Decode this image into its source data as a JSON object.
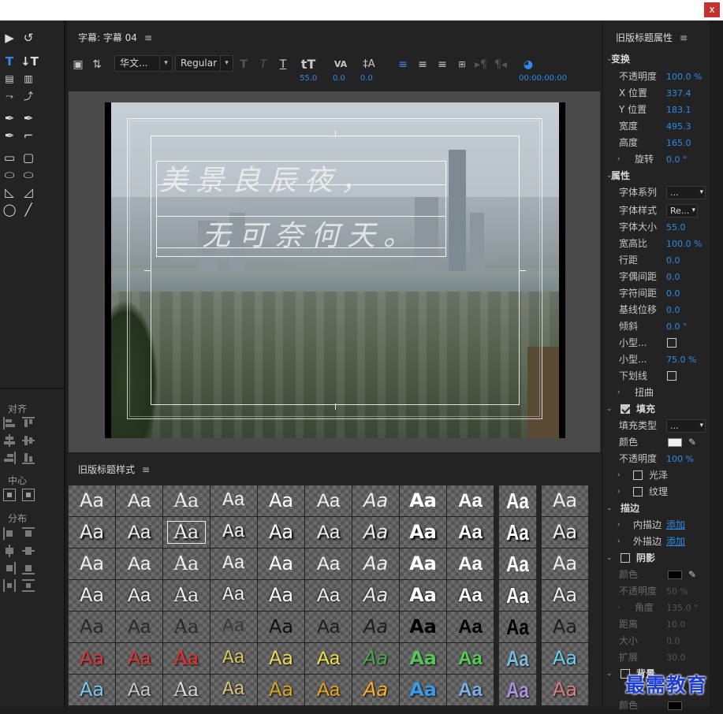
{
  "window": {
    "close_label": "x"
  },
  "title_panel": {
    "tab_label": "字幕: 字幕 04",
    "menu_glyph": "≡",
    "font_family": "华文...",
    "font_style": "Regular",
    "font_size": "55.0",
    "kerning": "0.0",
    "leading": "0.0",
    "timecode": "00:00:00:00",
    "line1": "美景良辰夜，",
    "line2": "无可奈何天。"
  },
  "tools_panel": {
    "align_label": "对齐",
    "center_label": "中心",
    "distribute_label": "分布"
  },
  "styles_panel": {
    "title": "旧版标题样式",
    "menu_glyph": "≡",
    "swatch_text": "Aa",
    "rows": [
      [
        "#eeeeee",
        "#eeeeee",
        "#eeeeee",
        "#eeeeee",
        "#ffffff",
        "#eeeeee",
        "#eeeeee",
        "#ffffff",
        "#ffffff",
        "#ffffff",
        "#eeeeee"
      ],
      [
        "#eeeeee",
        "#eeeeee",
        "#eeeeee",
        "#eeeeee",
        "#ffffff",
        "#eeeeee",
        "#eeeeee",
        "#ffffff",
        "#ffffff",
        "#ffffff",
        "#eeeeee"
      ],
      [
        "#eeeeee",
        "#eeeeee",
        "#eeeeee",
        "#eeeeee",
        "#ffffff",
        "#eeeeee",
        "#eeeeee",
        "#ffffff",
        "#ffffff",
        "#ffffff",
        "#eeeeee"
      ],
      [
        "#eeeeee",
        "#eeeeee",
        "#eeeeee",
        "#eeeeee",
        "#ffffff",
        "#eeeeee",
        "#eeeeee",
        "#ffffff",
        "#ffffff",
        "#ffffff",
        "#eeeeee"
      ],
      [
        "#2a2a2a",
        "#2a2a2a",
        "#2a2a2a",
        "#3a3a3a",
        "#111111",
        "#1e1e1e",
        "#1e1e1e",
        "#000000",
        "#000000",
        "#000000",
        "#1e1e1e"
      ],
      [
        "#d43b3b",
        "#e03a3a",
        "#ff2a2a",
        "#d9c760",
        "#e8d85a",
        "#f2e24a",
        "#4aa84a",
        "#5ac25a",
        "#55cc55",
        "#7ab8dc",
        "#6ad0f0"
      ],
      [
        "#7ac8f0",
        "#c8c8c8",
        "#d8d8d8",
        "#e2c080",
        "#d9a520",
        "#e8a818",
        "#ffb020",
        "#3a9ae8",
        "#7ab0e8",
        "#a890d8",
        "#d88080"
      ]
    ]
  },
  "properties_panel": {
    "title": "旧版标题属性",
    "menu_glyph": "≡",
    "transform": "变换",
    "opacity_label": "不透明度",
    "opacity": "100.0 %",
    "x_label": "X 位置",
    "x": "337.4",
    "y_label": "Y 位置",
    "y": "183.1",
    "width_label": "宽度",
    "width": "495.3",
    "height_label": "高度",
    "height": "165.0",
    "rotation_label": "旋转",
    "rotation": "0.0 °",
    "properties": "属性",
    "font_family_label": "字体系列",
    "font_family_value": "...",
    "font_style_label": "字体样式",
    "font_style_value": "Re...",
    "font_size_label": "字体大小",
    "font_size": "55.0",
    "aspect_label": "宽高比",
    "aspect": "100.0 %",
    "leading_label": "行距",
    "leading": "0.0",
    "kerning_label": "字偶间距",
    "kerning": "0.0",
    "tracking_label": "字符间距",
    "tracking": "0.0",
    "baseline_label": "基线位移",
    "baseline": "0.0",
    "slant_label": "倾斜",
    "slant": "0.0 °",
    "smallcaps_label": "小型...",
    "smallcaps_size_label": "小型...",
    "smallcaps_size": "75.0 %",
    "underline_label": "下划线",
    "distort_label": "扭曲",
    "fill": "填充",
    "fill_type_label": "填充类型",
    "fill_type_value": "...",
    "color_label": "颜色",
    "fill_color": "#f0f0f0",
    "fill_opacity_label": "不透明度",
    "fill_opacity": "100 %",
    "sheen_label": "光泽",
    "texture_label": "纹理",
    "stroke": "描边",
    "inner_stroke_label": "内描边",
    "inner_stroke_add": "添加",
    "outer_stroke_label": "外描边",
    "outer_stroke_add": "添加",
    "shadow": "阴影",
    "shadow_color_label": "颜色",
    "shadow_color": "#000000",
    "shadow_opacity_label": "不透明度",
    "shadow_opacity": "50 %",
    "shadow_angle_label": "角度",
    "shadow_angle": "135.0 °",
    "shadow_distance_label": "距离",
    "shadow_distance": "10.0",
    "shadow_size_label": "大小",
    "shadow_size": "0.0",
    "shadow_spread_label": "扩展",
    "shadow_spread": "30.0",
    "background": "背景",
    "bg_color_label": "颜色"
  },
  "watermark": "最需教育"
}
